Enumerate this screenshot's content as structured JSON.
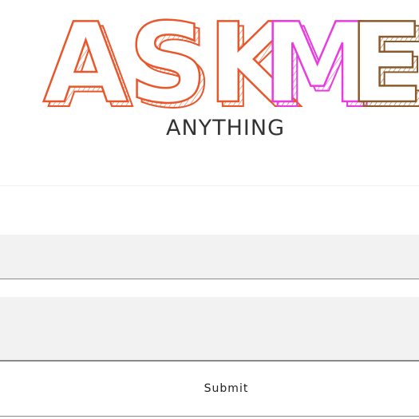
{
  "hero": {
    "title_word_1": "ASK",
    "title_word_2_part_1": "M",
    "title_word_2_part_2": "E",
    "subtitle": "ANYTHING",
    "colors": {
      "orange": "#e8562a",
      "magenta": "#e83be0",
      "brown": "#8b5a2b",
      "text": "#333333"
    }
  },
  "form": {
    "name_value": "",
    "question_value": "",
    "submit_label": "Submit"
  }
}
